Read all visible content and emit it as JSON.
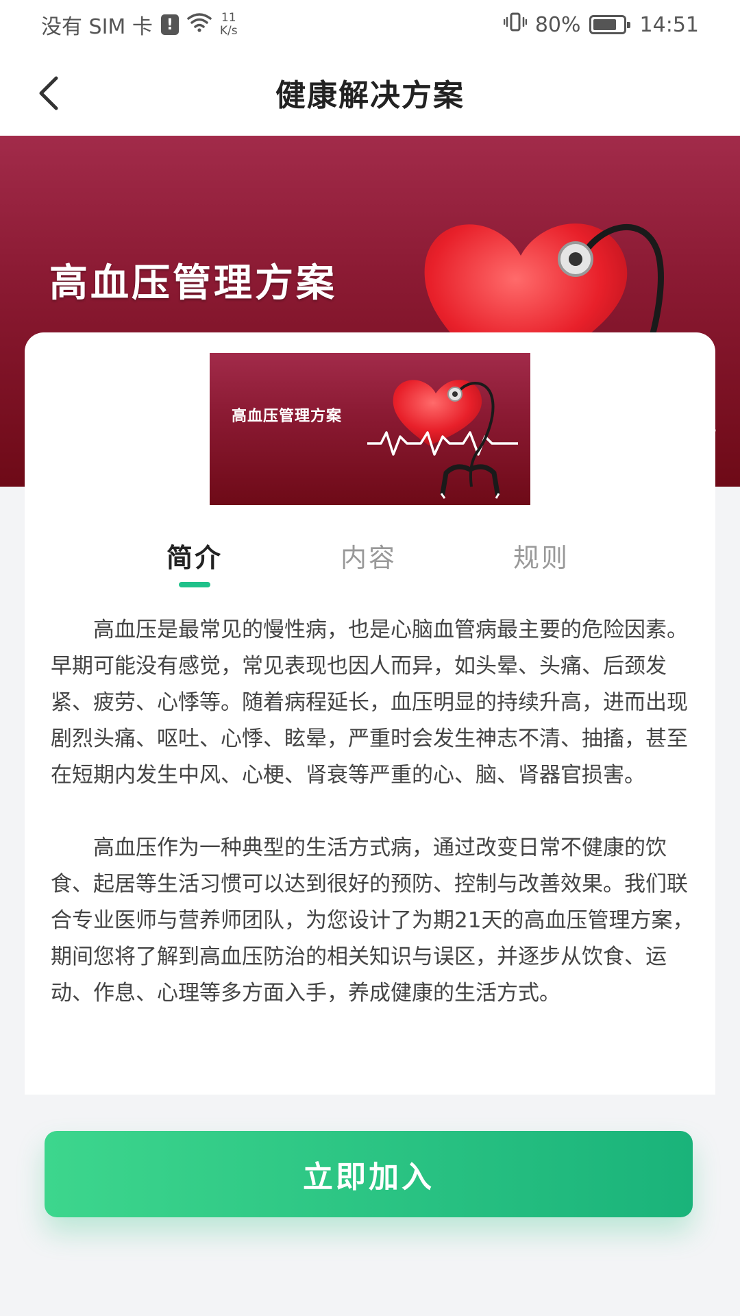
{
  "status_bar": {
    "carrier": "没有 SIM 卡",
    "sim_alert": "!",
    "net_speed_value": "11",
    "net_speed_unit": "K/s",
    "battery": "80%",
    "battery_level": 0.8,
    "time": "14:51",
    "icons": [
      "sim-alert-icon",
      "wifi-icon",
      "vibrate-icon",
      "battery-icon"
    ]
  },
  "nav": {
    "title": "健康解决方案",
    "back_icon": "chevron-left-icon"
  },
  "banner": {
    "title": "高血压管理方案",
    "art_icons": [
      "heart-icon",
      "heartbeat-line",
      "stethoscope-icon"
    ]
  },
  "card": {
    "thumbnail_title": "高血压管理方案",
    "tabs": [
      {
        "label": "简介",
        "active": true
      },
      {
        "label": "内容",
        "active": false
      },
      {
        "label": "规则",
        "active": false
      }
    ],
    "paragraphs": [
      "高血压是最常见的慢性病，也是心脑血管病最主要的危险因素。早期可能没有感觉，常见表现也因人而异，如头晕、头痛、后颈发紧、疲劳、心悸等。随着病程延长，血压明显的持续升高，进而出现剧烈头痛、呕吐、心悸、眩晕，严重时会发生神志不清、抽搐，甚至在短期内发生中风、心梗、肾衰等严重的心、脑、肾器官损害。",
      "高血压作为一种典型的生活方式病，通过改变日常不健康的饮食、起居等生活习惯可以达到很好的预防、控制与改善效果。我们联合专业医师与营养师团队，为您设计了为期21天的高血压管理方案，期间您将了解到高血压防治的相关知识与误区，并逐步从饮食、运动、作息、心理等多方面入手，养成健康的生活方式。"
    ]
  },
  "action": {
    "join_label": "立即加入"
  },
  "colors": {
    "accent": "#1fc18a",
    "banner_dark": "#6e0a17",
    "banner_light": "#a22b4a"
  }
}
